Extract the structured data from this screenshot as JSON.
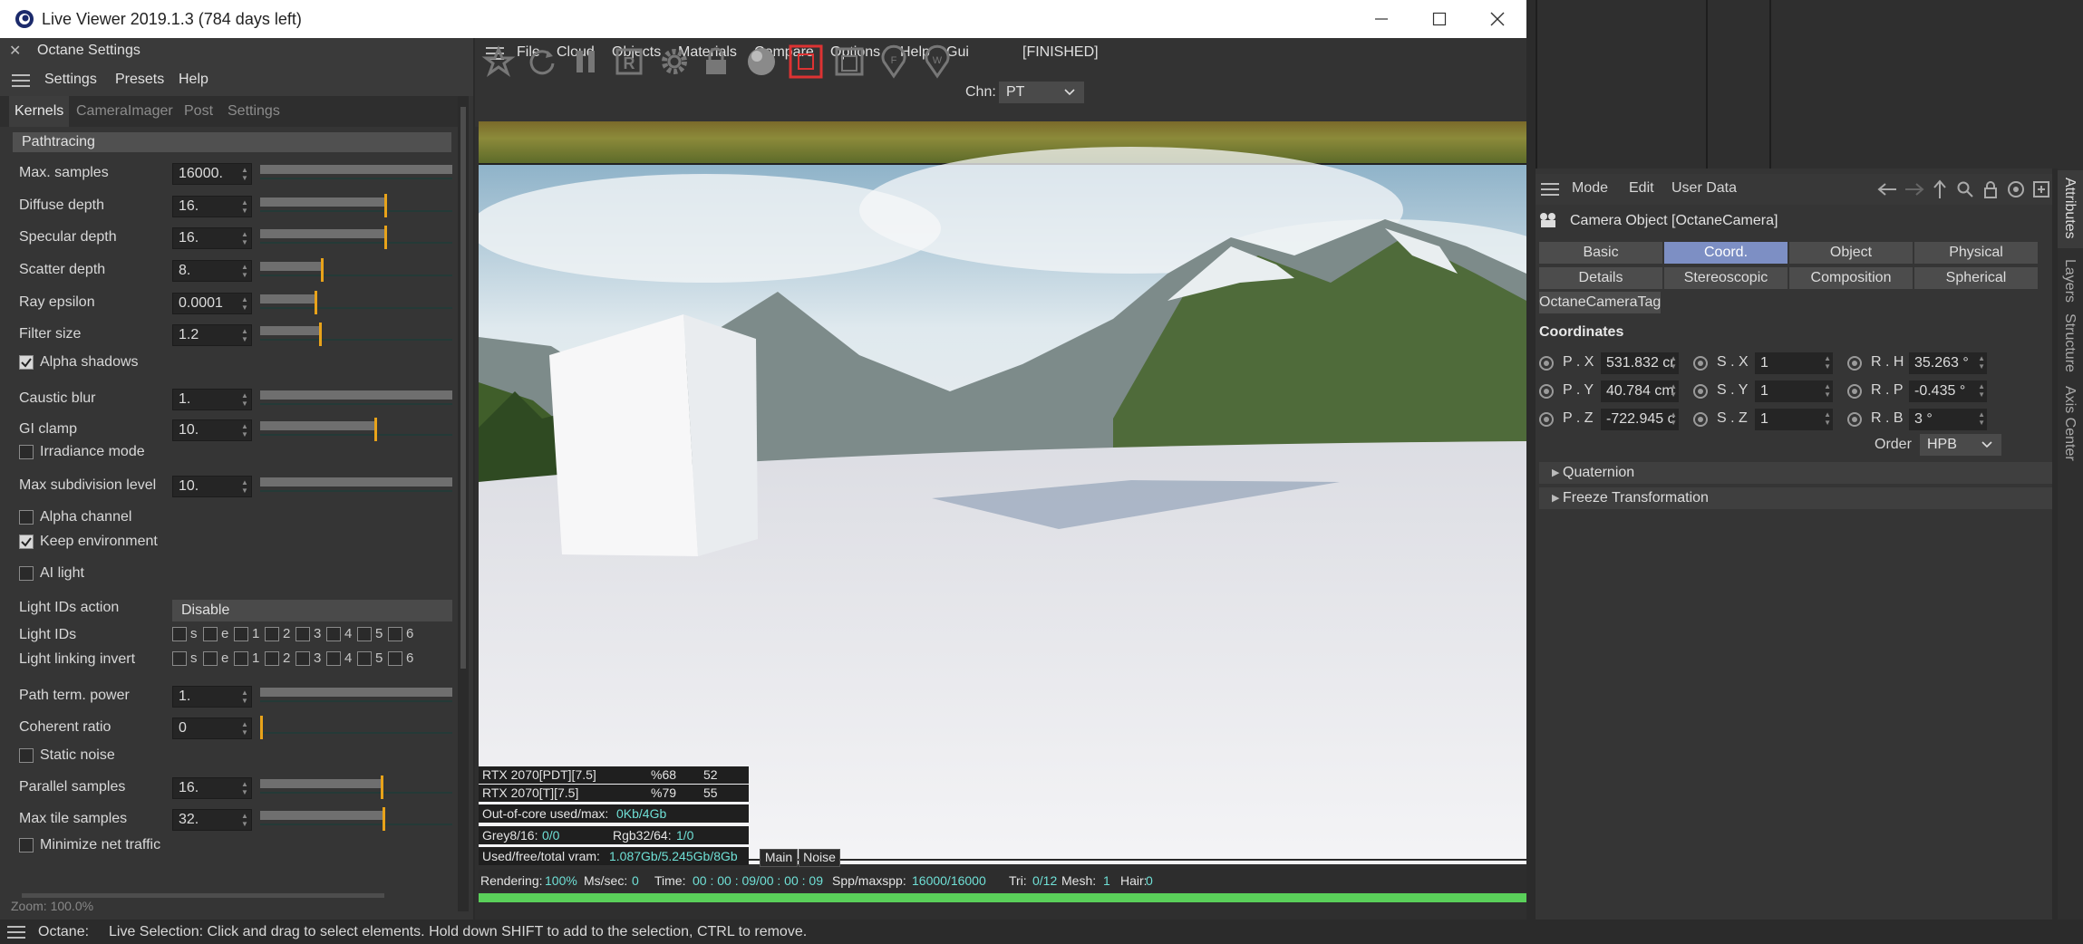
{
  "window": {
    "title": "Live Viewer 2019.1.3 (784 days left)",
    "minimize_icon": "minimize-icon",
    "maximize_icon": "maximize-icon",
    "close_icon": "close-icon"
  },
  "settings_panel": {
    "title": "Octane Settings",
    "menu": [
      "Settings",
      "Presets",
      "Help"
    ],
    "tabs": [
      "Kernels",
      "CameraImager",
      "Post",
      "Settings"
    ],
    "active_tab": "Kernels",
    "section": "Pathtracing",
    "params": [
      {
        "label": "Max. samples",
        "value": "16000.",
        "fill": 1.0
      },
      {
        "label": "Diffuse depth",
        "value": "16.",
        "fill": 0.65
      },
      {
        "label": "Specular depth",
        "value": "16.",
        "fill": 0.65
      },
      {
        "label": "Scatter depth",
        "value": "8.",
        "fill": 0.32
      },
      {
        "label": "Ray epsilon",
        "value": "0.0001",
        "fill": 0.29
      },
      {
        "label": "Filter size",
        "value": "1.2",
        "fill": 0.31
      },
      {
        "label": "Caustic blur",
        "value": "1.",
        "fill": 1.0
      },
      {
        "label": "GI clamp",
        "value": "10.",
        "fill": 0.6
      },
      {
        "label": "Max subdivision level",
        "value": "10.",
        "fill": 1.0
      },
      {
        "label": "Path term. power",
        "value": "1.",
        "fill": 1.0
      },
      {
        "label": "Coherent ratio",
        "value": "0",
        "fill": 0.0
      },
      {
        "label": "Parallel samples",
        "value": "16.",
        "fill": 0.63
      },
      {
        "label": "Max tile samples",
        "value": "32.",
        "fill": 0.64
      }
    ],
    "checks": {
      "alpha_shadows": {
        "label": "Alpha shadows",
        "checked": true
      },
      "irradiance_mode": {
        "label": "Irradiance mode",
        "checked": false
      },
      "alpha_channel": {
        "label": "Alpha channel",
        "checked": false
      },
      "keep_environment": {
        "label": "Keep environment",
        "checked": true
      },
      "ai_light": {
        "label": "AI light",
        "checked": false
      },
      "static_noise": {
        "label": "Static noise",
        "checked": false
      },
      "minimize_net_traffic": {
        "label": "Minimize net traffic",
        "checked": false
      }
    },
    "light_ids_action_label": "Light IDs action",
    "light_ids_action_value": "Disable",
    "light_ids_label": "Light IDs",
    "light_linking_label": "Light linking invert",
    "id_cells": [
      "s",
      "e",
      "1",
      "2",
      "3",
      "4",
      "5",
      "6"
    ],
    "zoom_text": "Zoom: 100.0%"
  },
  "viewer": {
    "menu": [
      "File",
      "Cloud",
      "Objects",
      "Materials",
      "Compare",
      "Options",
      "Help",
      "Gui"
    ],
    "state": "[FINISHED]",
    "channel_label": "Chn:",
    "channel_value": "PT",
    "gpu_rows": [
      {
        "name": "RTX 2070[PDT][7.5]",
        "pct": "%68",
        "temp": "52"
      },
      {
        "name": "RTX 2070[T][7.5]",
        "pct": "%79",
        "temp": "55"
      }
    ],
    "ooc_label": "Out-of-core used/max:",
    "ooc_value": "0Kb/4Gb",
    "grey_label": "Grey8/16:",
    "grey_value": "0/0",
    "rgb_label": "Rgb32/64:",
    "rgb_value": "1/0",
    "vram_label": "Used/free/total vram:",
    "vram_value": "1.087Gb/5.245Gb/8Gb",
    "tab_main": "Main",
    "tab_noise": "Noise",
    "status": {
      "rendering_label": "Rendering:",
      "rendering_value": "100%",
      "ms_label": "Ms/sec:",
      "ms_value": "0",
      "time_label": "Time:",
      "time_value": "00 : 00 : 09/00 : 00 : 09",
      "spp_label": "Spp/maxspp:",
      "spp_value": "16000/16000",
      "tri_label": "Tri:",
      "tri_value": "0/12",
      "mesh_label": "Mesh:",
      "mesh_value": "1",
      "hair_label": "Hair:",
      "hair_value": "0"
    },
    "progress": 1.0,
    "progress_color": "#5ad05a"
  },
  "attributes": {
    "menu": [
      "Mode",
      "Edit",
      "User Data"
    ],
    "object_title": "Camera Object [OctaneCamera]",
    "tabs_row1": [
      "Basic",
      "Coord.",
      "Object",
      "Physical"
    ],
    "tabs_row2": [
      "Details",
      "Stereoscopic",
      "Composition",
      "Spherical"
    ],
    "tag_tab": "OctaneCameraTag",
    "active_tab": "Coord.",
    "active_color": "#7d8fc4",
    "coordinates_header": "Coordinates",
    "pos": [
      {
        "label": "P . X",
        "value": "531.832 cr"
      },
      {
        "label": "P . Y",
        "value": "40.784 cm"
      },
      {
        "label": "P . Z",
        "value": "-722.945 c"
      }
    ],
    "scale": [
      {
        "label": "S . X",
        "value": "1"
      },
      {
        "label": "S . Y",
        "value": "1"
      },
      {
        "label": "S . Z",
        "value": "1"
      }
    ],
    "rot": [
      {
        "label": "R . H",
        "value": "35.263 °"
      },
      {
        "label": "R . P",
        "value": "-0.435 °"
      },
      {
        "label": "R . B",
        "value": "3 °"
      }
    ],
    "order_label": "Order",
    "order_value": "HPB",
    "quaternion": "Quaternion",
    "freeze": "Freeze Transformation",
    "side_tabs": [
      "Attributes",
      "Layers",
      "Structure",
      "Axis Center"
    ]
  },
  "bottom": {
    "app": "Octane:",
    "message": "Live Selection: Click and drag to select elements. Hold down SHIFT to add to the selection, CTRL to remove."
  }
}
